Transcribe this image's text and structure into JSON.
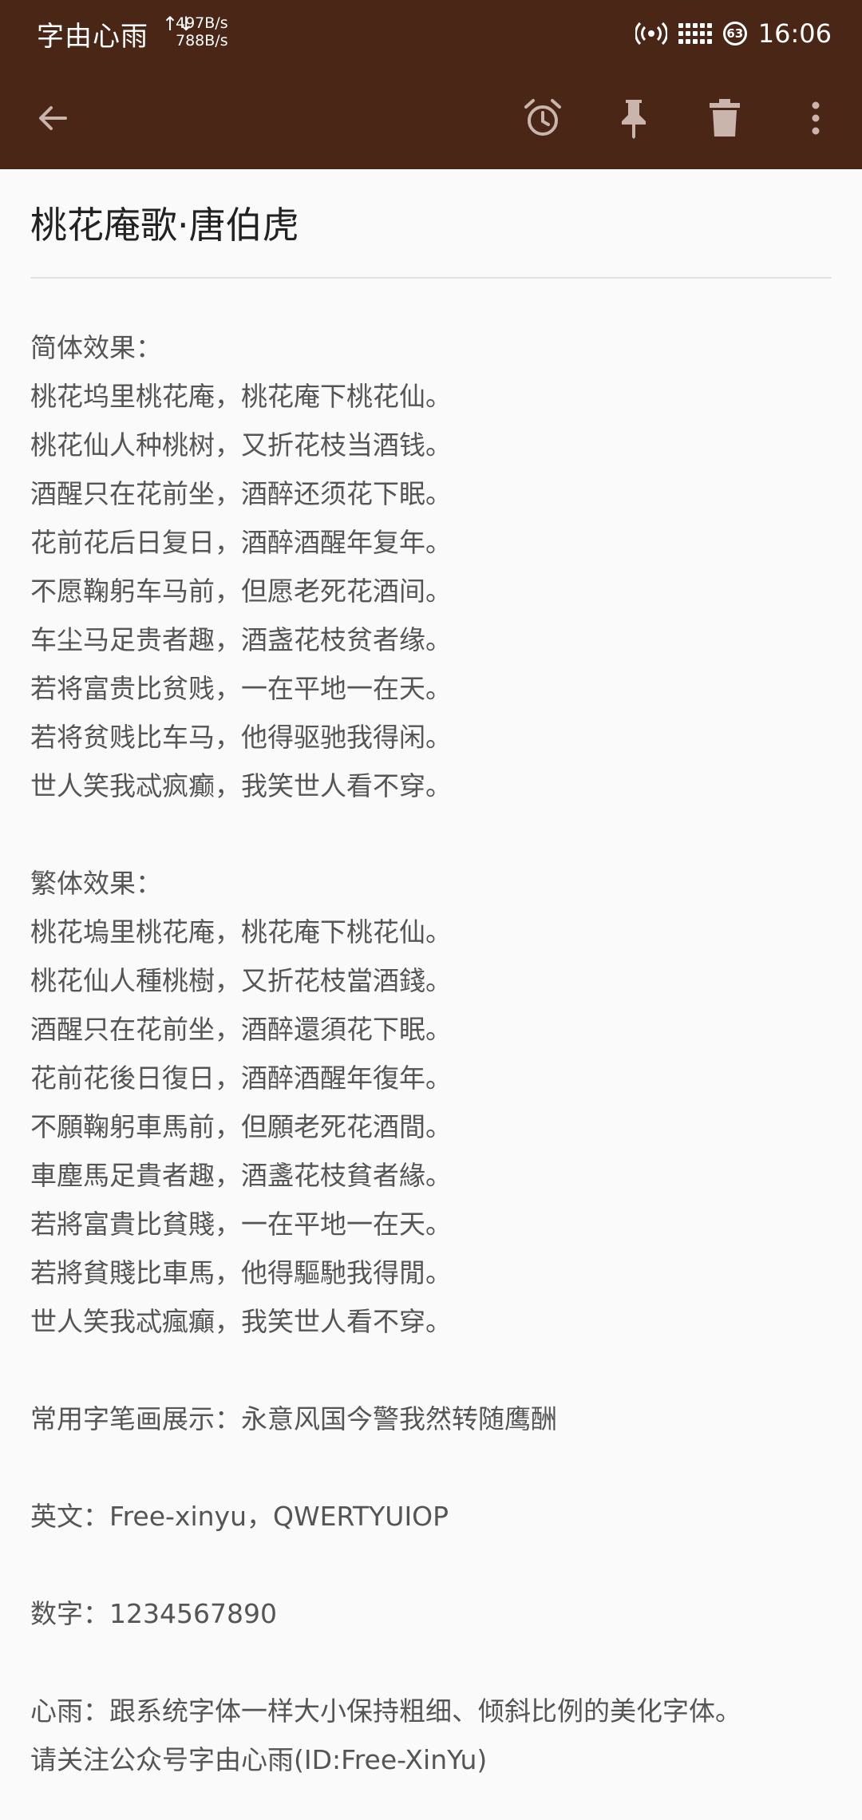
{
  "status": {
    "brand": "字由心雨",
    "net_arrows": "↑↓",
    "net_up": "497B/s",
    "net_down": "788B/s",
    "battery": "63",
    "time": "16:06"
  },
  "toolbar": {
    "icons": [
      "back-arrow-icon",
      "alarm-clock-icon",
      "pin-icon",
      "trash-icon",
      "more-vert-icon"
    ]
  },
  "note": {
    "title": "桃花庵歌·唐伯虎",
    "lines": [
      "简体效果：",
      "桃花坞里桃花庵，桃花庵下桃花仙。",
      "桃花仙人种桃树，又折花枝当酒钱。",
      "酒醒只在花前坐，酒醉还须花下眠。",
      "花前花后日复日，酒醉酒醒年复年。",
      "不愿鞠躬车马前，但愿老死花酒间。",
      "车尘马足贵者趣，酒盏花枝贫者缘。",
      "若将富贵比贫贱，一在平地一在天。",
      "若将贫贱比车马，他得驱驰我得闲。",
      "世人笑我忒疯癫，我笑世人看不穿。",
      "",
      "繁体效果：",
      "桃花塢里桃花庵，桃花庵下桃花仙。",
      "桃花仙人種桃樹，又折花枝當酒錢。",
      "酒醒只在花前坐，酒醉還須花下眠。",
      "花前花後日復日，酒醉酒醒年復年。",
      "不願鞠躬車馬前，但願老死花酒間。",
      "車塵馬足貴者趣，酒盞花枝貧者緣。",
      "若將富貴比貧賤，一在平地一在天。",
      "若將貧賤比車馬，他得驅馳我得閒。",
      "世人笑我忒瘋癲，我笑世人看不穿。",
      "",
      "常用字笔画展示：永意风国今警我然转随鹰酬",
      "",
      "英文：Free-xinyu，QWERTYUIOP",
      "",
      "数字：1234567890",
      "",
      "心雨：跟系统字体一样大小保持粗细、倾斜比例的美化字体。",
      "请关注公众号字由心雨(ID:Free-XinYu)"
    ]
  },
  "colors": {
    "bar": "#4a2617",
    "background": "#fafafa",
    "text": "#555555",
    "title": "#222222"
  }
}
